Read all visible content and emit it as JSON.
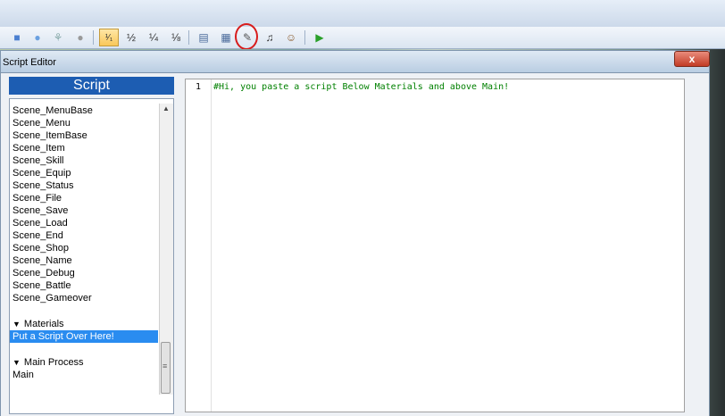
{
  "window": {
    "title": "Script Editor",
    "close_glyph": "x"
  },
  "toolbar": {
    "buttons": [
      {
        "icon": "square-icon",
        "glyph": "■"
      },
      {
        "icon": "circle-icon",
        "glyph": "●"
      },
      {
        "icon": "fill-icon",
        "glyph": "⚘"
      },
      {
        "icon": "dot-icon",
        "glyph": "●"
      },
      {
        "icon": "scale-1-1-icon",
        "glyph": "¹⁄₁"
      },
      {
        "icon": "scale-1-2-icon",
        "glyph": "½"
      },
      {
        "icon": "scale-1-4-icon",
        "glyph": "¼"
      },
      {
        "icon": "scale-1-8-icon",
        "glyph": "⅛"
      },
      {
        "icon": "database-icon",
        "glyph": "▤"
      },
      {
        "icon": "resource-manager-icon",
        "glyph": "▦"
      },
      {
        "icon": "script-editor-icon",
        "glyph": "✎"
      },
      {
        "icon": "sound-test-icon",
        "glyph": "♫"
      },
      {
        "icon": "character-generator-icon",
        "glyph": "☺"
      },
      {
        "icon": "playtest-icon",
        "glyph": "▶"
      }
    ]
  },
  "script_list": {
    "header": "Script",
    "scenes": [
      "Scene_MenuBase",
      "Scene_Menu",
      "Scene_ItemBase",
      "Scene_Item",
      "Scene_Skill",
      "Scene_Equip",
      "Scene_Status",
      "Scene_File",
      "Scene_Save",
      "Scene_Load",
      "Scene_End",
      "Scene_Shop",
      "Scene_Name",
      "Scene_Debug",
      "Scene_Battle",
      "Scene_Gameover"
    ],
    "materials_label": "Materials",
    "materials_selected": "Put a Script Over Here!",
    "main_process_label": "Main Process",
    "main_item": "Main"
  },
  "editor": {
    "line_number": "1",
    "code": "#Hi, you paste a script Below Materials and above Main!"
  }
}
